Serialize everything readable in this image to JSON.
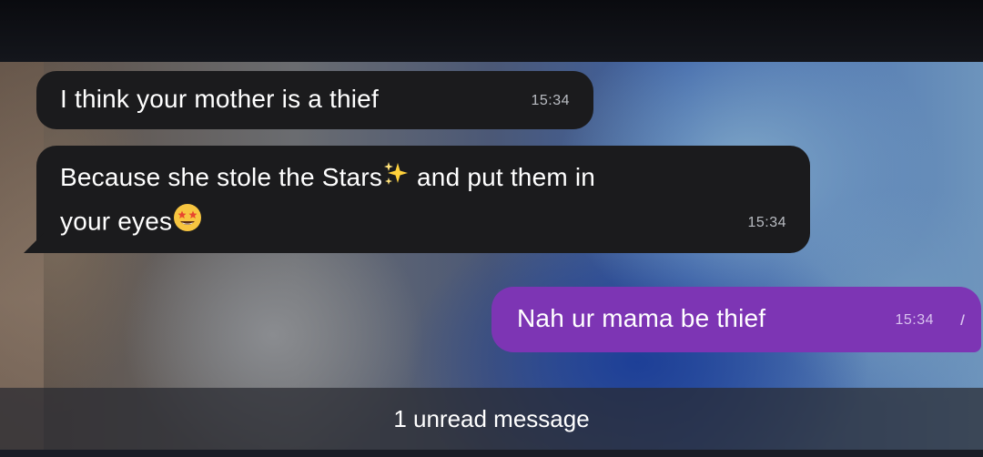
{
  "messages": [
    {
      "direction": "incoming",
      "text": "I think your mother is a thief",
      "time": "15:34"
    },
    {
      "direction": "incoming",
      "text_line1_a": "Because she stole the Stars",
      "text_line1_b": " and put them in",
      "text_line2": "your eyes",
      "time": "15:34",
      "emojis": [
        "sparkles-emoji",
        "star-struck-emoji"
      ]
    },
    {
      "direction": "outgoing",
      "text": "Nah ur mama be thief",
      "time": "15:34",
      "status": "read-double-check"
    }
  ],
  "unread_banner": {
    "label": "1 unread message"
  },
  "colors": {
    "incoming_bubble": "#1b1b1d",
    "outgoing_bubble": "#7d35b4",
    "banner": "#282a30"
  }
}
